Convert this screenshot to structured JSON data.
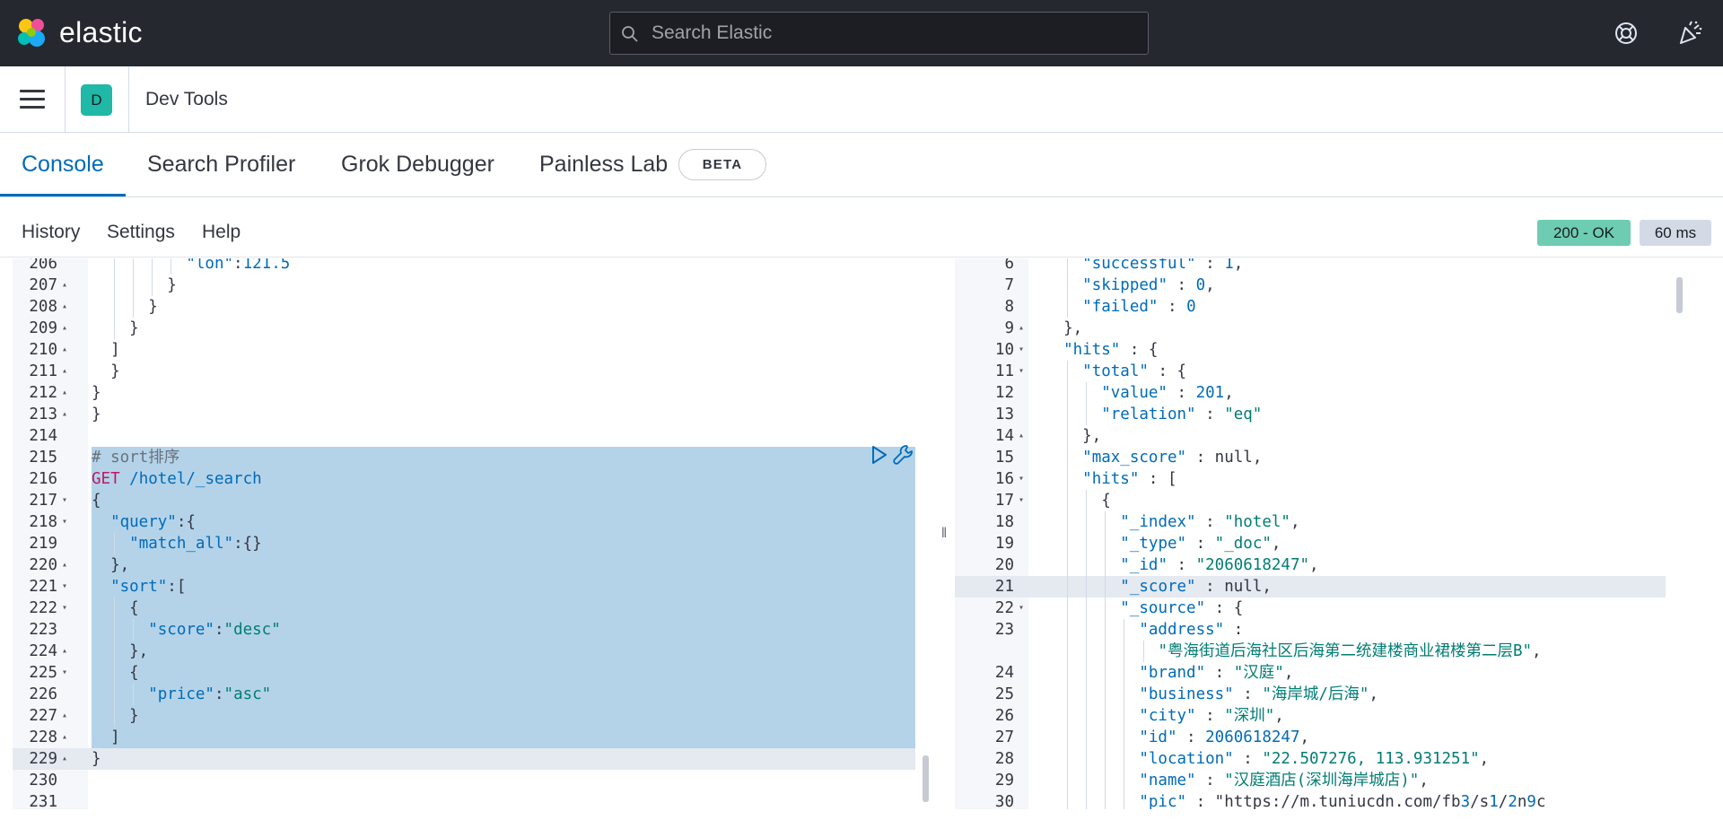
{
  "header": {
    "brand": "elastic",
    "search_placeholder": "Search Elastic",
    "icons": [
      "help-icon",
      "newsfeed-icon"
    ]
  },
  "breadcrumb": {
    "space_initial": "D",
    "app_title": "Dev Tools"
  },
  "tabs": [
    {
      "label": "Console",
      "active": true
    },
    {
      "label": "Search Profiler",
      "active": false
    },
    {
      "label": "Grok Debugger",
      "active": false
    },
    {
      "label": "Painless Lab",
      "active": false
    }
  ],
  "beta_label": "BETA",
  "toolbar": {
    "history": "History",
    "settings": "Settings",
    "help": "Help"
  },
  "status": {
    "code": "200 - OK",
    "time": "60 ms",
    "ok_color": "#6dccb1"
  },
  "colors": {
    "header_bg": "#25282f",
    "accent": "#006bb8",
    "selection": "#b4d3e9"
  },
  "request_editor": {
    "lines": [
      {
        "n": "206",
        "text": "          \"lon\":121.5"
      },
      {
        "n": "207",
        "text": "        }"
      },
      {
        "n": "208",
        "text": "      }"
      },
      {
        "n": "209",
        "text": "    }"
      },
      {
        "n": "210",
        "text": "  ]"
      },
      {
        "n": "211",
        "text": "  }"
      },
      {
        "n": "212",
        "text": "}"
      },
      {
        "n": "213",
        "text": "}"
      },
      {
        "n": "214",
        "text": ""
      },
      {
        "n": "215",
        "text": "# sort排序"
      },
      {
        "n": "216",
        "text": "GET /hotel/_search"
      },
      {
        "n": "217",
        "text": "{"
      },
      {
        "n": "218",
        "text": "  \"query\":{"
      },
      {
        "n": "219",
        "text": "    \"match_all\":{}"
      },
      {
        "n": "220",
        "text": "  },"
      },
      {
        "n": "221",
        "text": "  \"sort\":["
      },
      {
        "n": "222",
        "text": "    {"
      },
      {
        "n": "223",
        "text": "      \"score\":\"desc\""
      },
      {
        "n": "224",
        "text": "    },"
      },
      {
        "n": "225",
        "text": "    {"
      },
      {
        "n": "226",
        "text": "      \"price\":\"asc\""
      },
      {
        "n": "227",
        "text": "    }"
      },
      {
        "n": "228",
        "text": "  ]"
      },
      {
        "n": "229",
        "text": "}"
      },
      {
        "n": "230",
        "text": ""
      },
      {
        "n": "231",
        "text": ""
      }
    ]
  },
  "response_editor": {
    "lines": [
      {
        "n": "6",
        "text": "    \"successful\" : 1,"
      },
      {
        "n": "7",
        "text": "    \"skipped\" : 0,"
      },
      {
        "n": "8",
        "text": "    \"failed\" : 0"
      },
      {
        "n": "9",
        "text": "  },"
      },
      {
        "n": "10",
        "text": "  \"hits\" : {"
      },
      {
        "n": "11",
        "text": "    \"total\" : {"
      },
      {
        "n": "12",
        "text": "      \"value\" : 201,"
      },
      {
        "n": "13",
        "text": "      \"relation\" : \"eq\""
      },
      {
        "n": "14",
        "text": "    },"
      },
      {
        "n": "15",
        "text": "    \"max_score\" : null,"
      },
      {
        "n": "16",
        "text": "    \"hits\" : ["
      },
      {
        "n": "17",
        "text": "      {"
      },
      {
        "n": "18",
        "text": "        \"_index\" : \"hotel\","
      },
      {
        "n": "19",
        "text": "        \"_type\" : \"_doc\","
      },
      {
        "n": "20",
        "text": "        \"_id\" : \"2060618247\","
      },
      {
        "n": "21",
        "text": "        \"_score\" : null,"
      },
      {
        "n": "22",
        "text": "        \"_source\" : {"
      },
      {
        "n": "23",
        "text": "          \"address\" :"
      },
      {
        "n": "",
        "text": "            \"粤海街道后海社区后海第二统建楼商业裙楼第二层B\","
      },
      {
        "n": "24",
        "text": "          \"brand\" : \"汉庭\","
      },
      {
        "n": "25",
        "text": "          \"business\" : \"海岸城/后海\","
      },
      {
        "n": "26",
        "text": "          \"city\" : \"深圳\","
      },
      {
        "n": "27",
        "text": "          \"id\" : 2060618247,"
      },
      {
        "n": "28",
        "text": "          \"location\" : \"22.507276, 113.931251\","
      },
      {
        "n": "29",
        "text": "          \"name\" : \"汉庭酒店(深圳海岸城店)\","
      },
      {
        "n": "30",
        "text": "          \"pic\" : \"https://m.tuniucdn.com/fb3/s1/2n9c"
      }
    ]
  }
}
